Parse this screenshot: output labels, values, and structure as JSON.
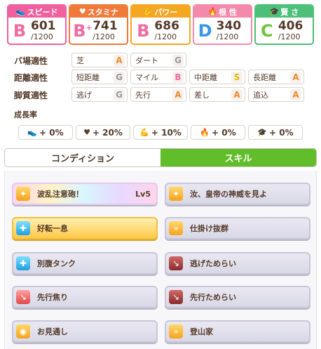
{
  "stats": [
    {
      "label": "スピード",
      "icon": "shoe-icon",
      "rank": "B",
      "plus": "",
      "value": "601",
      "max": "/1200",
      "color": "#f0609e",
      "rankClass": "rB"
    },
    {
      "label": "スタミナ",
      "icon": "heart-icon",
      "rank": "B",
      "plus": "+",
      "value": "741",
      "max": "/1200",
      "color": "#f07a3a",
      "rankClass": "rB"
    },
    {
      "label": "パワー",
      "icon": "arm-icon",
      "rank": "B",
      "plus": "",
      "value": "686",
      "max": "/1200",
      "color": "#f5a623",
      "rankClass": "rB"
    },
    {
      "label": "根 性",
      "icon": "flame-icon",
      "rank": "D",
      "plus": "",
      "value": "340",
      "max": "/1200",
      "color": "#f48aab",
      "rankClass": "rD"
    },
    {
      "label": "賢 さ",
      "icon": "graduation-cap-icon",
      "rank": "C",
      "plus": "",
      "value": "406",
      "max": "/1200",
      "color": "#4cbf78",
      "rankClass": "rC"
    }
  ],
  "aptitude": {
    "track": {
      "label": "バ場適性",
      "items": [
        {
          "name": "芝",
          "grade": "A"
        },
        {
          "name": "ダート",
          "grade": "G"
        }
      ]
    },
    "distance": {
      "label": "距離適性",
      "items": [
        {
          "name": "短距離",
          "grade": "G"
        },
        {
          "name": "マイル",
          "grade": "B"
        },
        {
          "name": "中距離",
          "grade": "S"
        },
        {
          "name": "長距離",
          "grade": "A"
        }
      ]
    },
    "style": {
      "label": "脚質適性",
      "items": [
        {
          "name": "逃げ",
          "grade": "G"
        },
        {
          "name": "先行",
          "grade": "A"
        },
        {
          "name": "差し",
          "grade": "A"
        },
        {
          "name": "追込",
          "grade": "A"
        }
      ]
    }
  },
  "growth": {
    "title": "成長率",
    "items": [
      {
        "icon": "shoe-icon",
        "glyph": "👟",
        "value": "+ 0%"
      },
      {
        "icon": "heart-icon",
        "glyph": "♥",
        "value": "+ 20%"
      },
      {
        "icon": "arm-icon",
        "glyph": "💪",
        "value": "+ 10%"
      },
      {
        "icon": "flame-icon",
        "glyph": "🔥",
        "value": "+ 0%"
      },
      {
        "icon": "graduation-cap-icon",
        "glyph": "🎓",
        "value": "+ 0%"
      }
    ]
  },
  "tabs": {
    "condition": "コンディション",
    "skill": "スキル",
    "active": "skill"
  },
  "skills": [
    {
      "name": "波乱注意砲！",
      "level": "Lv5",
      "style": "rainbow",
      "iconColor": "yellow",
      "icon": "star-burst-icon"
    },
    {
      "name": "汝、皇帝の神威を見よ",
      "level": "",
      "style": "",
      "iconColor": "yellow",
      "icon": "star-burst-icon"
    },
    {
      "name": "好転一息",
      "level": "",
      "style": "gold",
      "iconColor": "blue",
      "icon": "recovery-icon"
    },
    {
      "name": "仕掛け抜群",
      "level": "",
      "style": "",
      "iconColor": "yellow",
      "icon": "speed-up-icon"
    },
    {
      "name": "別腹タンク",
      "level": "",
      "style": "",
      "iconColor": "blue",
      "icon": "recovery-icon"
    },
    {
      "name": "逃げためらい",
      "level": "",
      "style": "",
      "iconColor": "dark",
      "icon": "debuff-icon"
    },
    {
      "name": "先行焦り",
      "level": "",
      "style": "",
      "iconColor": "red",
      "icon": "debuff-icon"
    },
    {
      "name": "先行ためらい",
      "level": "",
      "style": "",
      "iconColor": "dark",
      "icon": "debuff-icon"
    },
    {
      "name": "お見通し",
      "level": "",
      "style": "",
      "iconColor": "yellow",
      "icon": "vision-icon"
    },
    {
      "name": "登山家",
      "level": "",
      "style": "",
      "iconColor": "yellow",
      "icon": "speed-up-icon"
    }
  ]
}
